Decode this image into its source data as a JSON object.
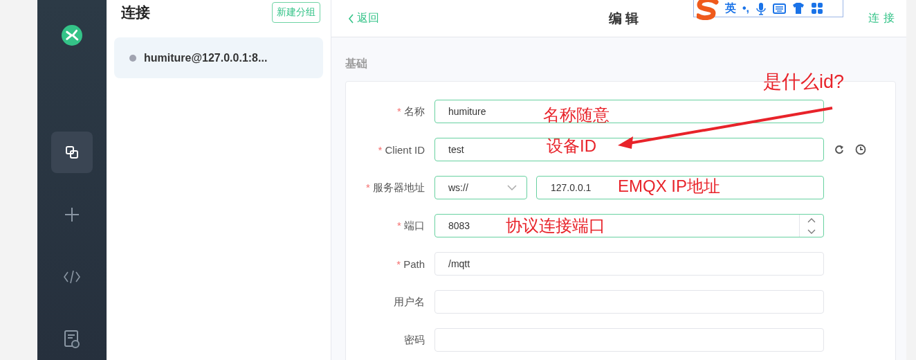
{
  "sidebar": {
    "items": [
      {
        "kind": "connections",
        "selected": true
      },
      {
        "kind": "new",
        "selected": false
      },
      {
        "kind": "script",
        "selected": false
      },
      {
        "kind": "log",
        "selected": false
      }
    ]
  },
  "connections": {
    "title": "连接",
    "new_group_button": "新建分组",
    "items": [
      {
        "name": "humiture@127.0.0.1:8...",
        "selected": true,
        "color": "#a0a3b0"
      }
    ]
  },
  "header": {
    "back": "返回",
    "title": "编 辑",
    "connect": "连 接"
  },
  "ime_toolbar": {
    "language": "英",
    "punctuation": "•,"
  },
  "form": {
    "section": "基础",
    "fields": [
      {
        "kind": "text",
        "required_mark": "*",
        "label": "名称",
        "value": "humiture",
        "valid": true
      },
      {
        "kind": "client-id",
        "required_mark": "*",
        "label": "Client ID",
        "value": "test",
        "valid": true
      },
      {
        "kind": "host",
        "required_mark": "*",
        "label": "服务器地址",
        "protocol": "ws://",
        "value": "127.0.0.1",
        "valid": true
      },
      {
        "kind": "number",
        "required_mark": "*",
        "label": "端口",
        "value": "8083",
        "valid": true
      },
      {
        "kind": "text",
        "required_mark": "*",
        "label": "Path",
        "value": "/mqtt",
        "valid": false
      },
      {
        "kind": "text",
        "label": "用户名",
        "valid": false
      },
      {
        "kind": "text",
        "label": "密码",
        "valid": false
      }
    ]
  },
  "annotations": [
    {
      "kind": "note",
      "text": "是什么id?"
    },
    {
      "kind": "arrow"
    },
    {
      "kind": "note",
      "text": "名称随意"
    },
    {
      "kind": "note",
      "text": "设备ID"
    },
    {
      "kind": "note",
      "text": "EMQX IP地址"
    },
    {
      "kind": "note",
      "text": "协议连接端口"
    }
  ]
}
